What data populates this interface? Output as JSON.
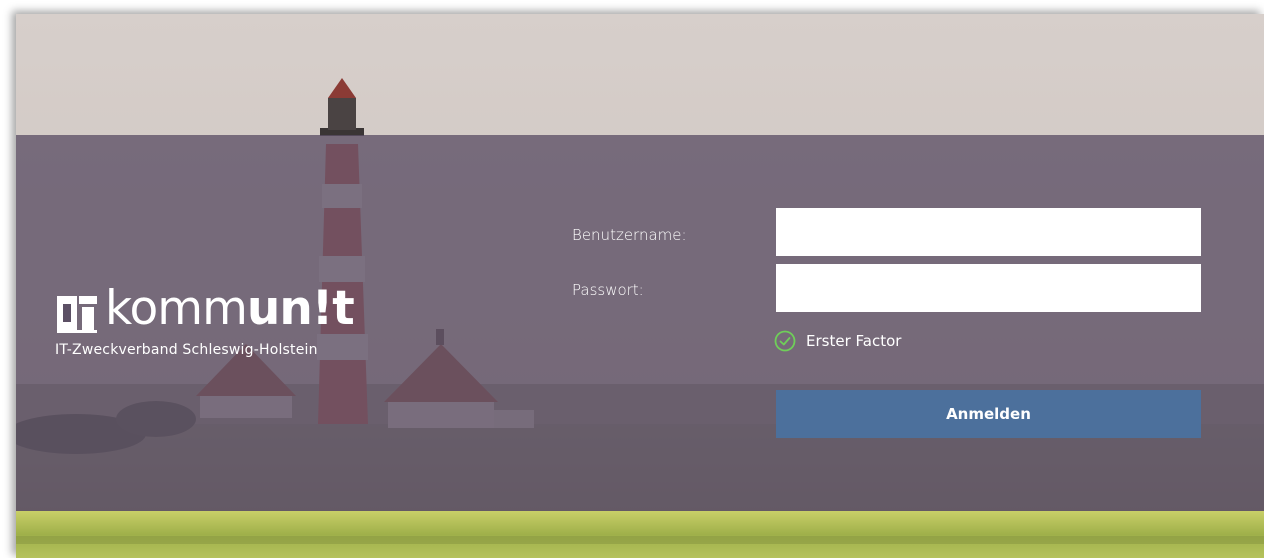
{
  "logo": {
    "name_light": "komm",
    "name_bold": "un!t",
    "subtitle": "IT-Zweckverband Schleswig-Holstein"
  },
  "form": {
    "username_label": "Benutzername:",
    "password_label": "Passwort:",
    "username_value": "",
    "password_value": "",
    "factor_label": "Erster Factor",
    "submit_label": "Anmelden"
  },
  "colors": {
    "overlay": "#5c5065",
    "button": "#4c709c",
    "check": "#6fcf59",
    "text": "#ffffff"
  },
  "icons": {
    "logo_mark": "kommunit-logo-mark-icon",
    "factor_status": "check-circle-icon"
  }
}
